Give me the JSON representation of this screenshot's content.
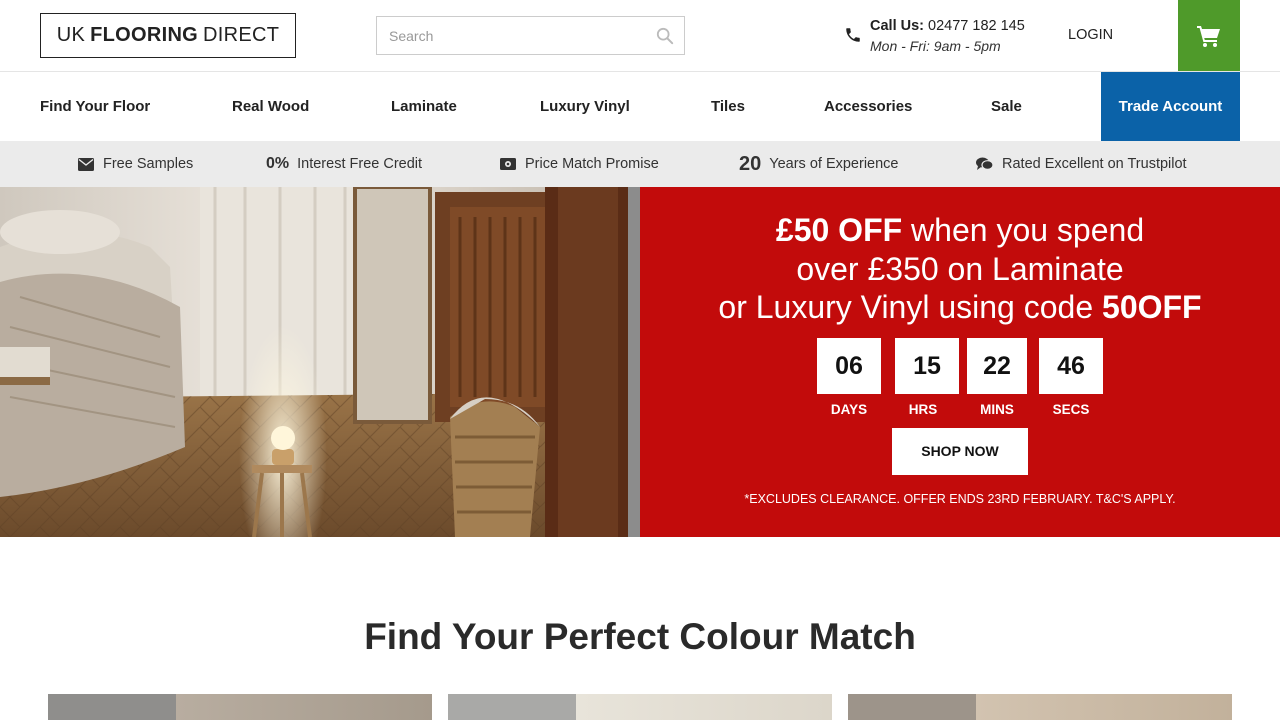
{
  "header": {
    "logo": {
      "prefix": "UK",
      "bold": "FLOORING",
      "suffix": "DIRECT"
    },
    "search": {
      "placeholder": "Search",
      "value": ""
    },
    "call_label": "Call Us:",
    "phone": "02477 182 145",
    "hours": "Mon - Fri: 9am - 5pm",
    "login": "LOGIN"
  },
  "nav": {
    "items": [
      "Find Your Floor",
      "Real Wood",
      "Laminate",
      "Luxury Vinyl",
      "Tiles",
      "Accessories",
      "Sale"
    ],
    "trade": "Trade Account"
  },
  "usp": {
    "free_samples": "Free Samples",
    "credit_num": "0%",
    "credit_text": "Interest Free Credit",
    "price_match": "Price Match Promise",
    "years_num": "20",
    "years_text": "Years of Experience",
    "trustpilot": "Rated Excellent on Trustpilot"
  },
  "promo": {
    "line1_bold": "£50 OFF",
    "line1_rest": " when you spend",
    "line2": "over £350 on Laminate",
    "line3": "or Luxury Vinyl using code ",
    "code": "50OFF",
    "countdown": [
      {
        "value": "06",
        "label": "DAYS"
      },
      {
        "value": "15",
        "label": "HRS"
      },
      {
        "value": "22",
        "label": "MINS"
      },
      {
        "value": "46",
        "label": "SECS"
      }
    ],
    "cta": "SHOP NOW",
    "terms": "*EXCLUDES CLEARANCE. OFFER ENDS 23RD FEBRUARY. T&C'S APPLY."
  },
  "section": {
    "title": "Find Your Perfect Colour Match"
  },
  "colors": {
    "cart_green": "#4f9a2a",
    "trade_blue": "#0b62a8",
    "promo_red": "#c20b0b",
    "usp_grey": "#ebebeb"
  }
}
